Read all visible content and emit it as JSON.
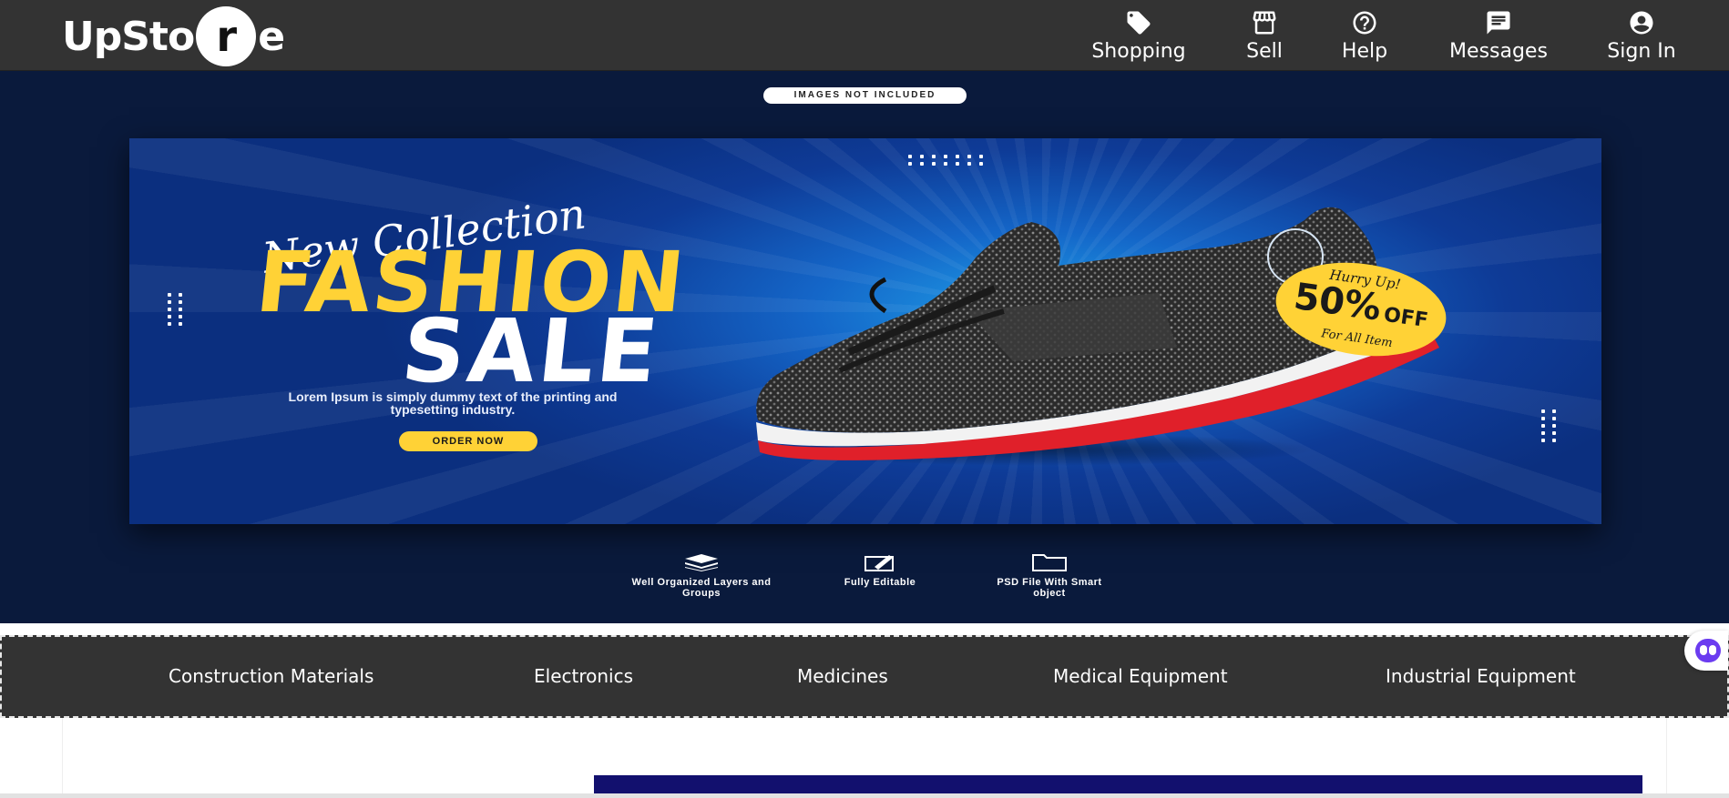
{
  "header": {
    "logo_pre": "UpSto",
    "logo_circle": "r",
    "logo_post": "e",
    "nav": [
      {
        "label": "Shopping",
        "icon": "tag-icon"
      },
      {
        "label": "Sell",
        "icon": "store-icon"
      },
      {
        "label": "Help",
        "icon": "help-icon"
      },
      {
        "label": "Messages",
        "icon": "message-icon"
      },
      {
        "label": "Sign In",
        "icon": "account-icon"
      }
    ]
  },
  "hero": {
    "badge": "IMAGES NOT INCLUDED",
    "headline_script": "New Collection",
    "headline_main": "FASHION",
    "headline_sub": "SALE",
    "description": "Lorem Ipsum is simply dummy text of the printing and typesetting industry.",
    "cta": "ORDER NOW",
    "tag_top": "Hurry Up!",
    "tag_main": "50%",
    "tag_off": "OFF",
    "tag_bottom": "For All Item",
    "features": [
      {
        "label": "Well Organized Layers and Groups",
        "icon": "layers-icon"
      },
      {
        "label": "Fully Editable",
        "icon": "edit-icon"
      },
      {
        "label": "PSD File With Smart object",
        "icon": "folder-icon"
      }
    ],
    "colors": {
      "accent": "#ffd236",
      "background": "#0a1a3c",
      "banner": "#0e3b97"
    }
  },
  "categories": [
    "Construction Materials",
    "Electronics",
    "Medicines",
    "Medical Equipment",
    "Industrial Equipment"
  ]
}
